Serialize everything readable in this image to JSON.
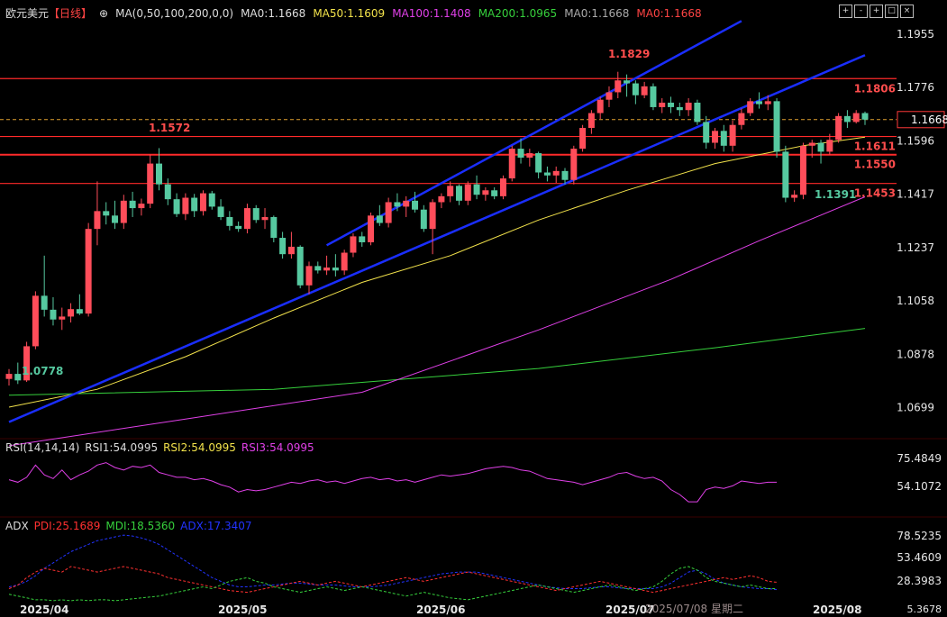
{
  "header": {
    "symbol": "欧元美元",
    "period": "【日线】",
    "ma_param": "MA(0,50,100,200,0,0)",
    "ma0": "MA0:1.1668",
    "ma50": "MA50:1.1609",
    "ma100": "MA100:1.1408",
    "ma200": "MA200:1.0965",
    "ma0b": "MA0:1.1668",
    "ma0c": "MA0:1.1668"
  },
  "toolbar": [
    "+",
    "-",
    "+",
    "□",
    "×"
  ],
  "colors": {
    "up": "#ff4d5a",
    "down": "#56c9a0",
    "ma50": "#f2e24b",
    "ma100": "#e040e8",
    "ma200": "#36d03c",
    "trend": "#1a2eff",
    "level": "#ff2a2a",
    "rsi": "#e040e8",
    "pdi": "#ff3030",
    "mdi": "#36d03c",
    "adx": "#2233ff"
  },
  "price_axis": [
    "1.1955",
    "1.1776",
    "1.1596",
    "1.1417",
    "1.1237",
    "1.1058",
    "1.0878",
    "1.0699"
  ],
  "current_price": "1.1668",
  "levels": [
    "1.1806",
    "1.1611",
    "1.1550",
    "1.1453"
  ],
  "annotations": {
    "high": "1.1829",
    "high_may": "1.1572",
    "low_apr": "1.0778",
    "low_aug": "1.1391"
  },
  "rsi": {
    "label": "RSI(14,14,14)",
    "rsi1": "RSI1:54.0995",
    "rsi2": "RSI2:54.0995",
    "rsi3": "RSI3:54.0995",
    "axis": [
      "75.4849",
      "54.1072"
    ],
    "values": [
      56,
      54,
      58,
      68,
      60,
      57,
      64,
      56,
      60,
      63,
      68,
      70,
      66,
      64,
      67,
      66,
      68,
      62,
      60,
      58,
      58,
      56,
      57,
      55,
      52,
      50,
      46,
      48,
      47,
      48,
      50,
      52,
      54,
      53,
      55,
      56,
      54,
      55,
      53,
      55,
      57,
      58,
      56,
      57,
      55,
      56,
      54,
      56,
      58,
      60,
      59,
      60,
      61,
      63,
      65,
      66,
      67,
      66,
      64,
      63,
      60,
      57,
      56,
      55,
      54,
      52,
      54,
      56,
      58,
      61,
      62,
      59,
      57,
      58,
      55,
      48,
      44,
      38,
      38,
      48,
      50,
      49,
      51,
      55,
      54,
      53,
      54,
      54
    ]
  },
  "adx": {
    "label": "ADX",
    "pdi": "PDI:25.1689",
    "mdi": "MDI:18.5360",
    "adx": "ADX:17.3407",
    "axis": [
      "78.5235",
      "53.4609",
      "28.3983",
      "5.3678"
    ],
    "pdi_values": [
      18,
      22,
      30,
      36,
      40,
      38,
      36,
      42,
      40,
      38,
      36,
      38,
      40,
      42,
      40,
      38,
      36,
      34,
      30,
      28,
      26,
      24,
      22,
      20,
      18,
      16,
      15,
      14,
      16,
      18,
      20,
      22,
      24,
      26,
      24,
      22,
      24,
      26,
      24,
      22,
      20,
      22,
      24,
      26,
      28,
      30,
      28,
      26,
      28,
      30,
      32,
      34,
      36,
      34,
      32,
      30,
      28,
      26,
      24,
      22,
      20,
      18,
      16,
      18,
      20,
      22,
      24,
      26,
      24,
      22,
      20,
      18,
      16,
      14,
      16,
      18,
      20,
      22,
      24,
      26,
      28,
      30,
      28,
      30,
      32,
      30,
      26,
      25
    ],
    "mdi_values": [
      12,
      10,
      8,
      6,
      6,
      5,
      6,
      5,
      6,
      5,
      6,
      6,
      5,
      6,
      7,
      8,
      9,
      10,
      12,
      14,
      16,
      18,
      20,
      18,
      22,
      26,
      28,
      30,
      26,
      24,
      20,
      18,
      16,
      14,
      16,
      18,
      20,
      18,
      16,
      18,
      20,
      18,
      16,
      14,
      12,
      10,
      12,
      14,
      12,
      10,
      8,
      7,
      6,
      8,
      10,
      12,
      14,
      16,
      18,
      20,
      22,
      20,
      18,
      16,
      14,
      16,
      18,
      20,
      22,
      20,
      18,
      16,
      18,
      20,
      26,
      34,
      40,
      42,
      38,
      30,
      26,
      24,
      22,
      20,
      22,
      20,
      18,
      18
    ],
    "adx_values": [
      20,
      22,
      26,
      32,
      40,
      46,
      52,
      58,
      62,
      66,
      70,
      72,
      74,
      76,
      75,
      73,
      70,
      66,
      60,
      54,
      48,
      42,
      36,
      30,
      26,
      22,
      20,
      20,
      21,
      22,
      22,
      23,
      24,
      24,
      23,
      22,
      22,
      22,
      21,
      20,
      20,
      20,
      21,
      22,
      24,
      26,
      28,
      30,
      32,
      34,
      35,
      36,
      36,
      36,
      34,
      32,
      30,
      28,
      26,
      24,
      22,
      20,
      19,
      18,
      18,
      18,
      19,
      20,
      20,
      19,
      18,
      18,
      18,
      18,
      20,
      24,
      30,
      36,
      38,
      34,
      28,
      24,
      22,
      20,
      19,
      18,
      18,
      17
    ]
  },
  "xaxis": {
    "labels": [
      "2025/04",
      "2025/05",
      "2025/06",
      "2025/07",
      "2025/07/08 星期二",
      "2025/08"
    ]
  },
  "chart_data": {
    "type": "line",
    "candles": [
      [
        1.0795,
        1.0828,
        1.0773,
        1.0812
      ],
      [
        1.0812,
        1.085,
        1.0778,
        1.079
      ],
      [
        1.079,
        1.092,
        1.0785,
        1.0905
      ],
      [
        1.0905,
        1.109,
        1.0895,
        1.1075
      ],
      [
        1.1075,
        1.121,
        1.1005,
        1.1028
      ],
      [
        1.1028,
        1.107,
        1.0975,
        1.0995
      ],
      [
        1.0995,
        1.1035,
        1.096,
        1.1005
      ],
      [
        1.1005,
        1.105,
        1.0985,
        1.103
      ],
      [
        1.103,
        1.108,
        1.101,
        1.1015
      ],
      [
        1.1015,
        1.132,
        1.1005,
        1.13
      ],
      [
        1.13,
        1.146,
        1.1245,
        1.136
      ],
      [
        1.136,
        1.139,
        1.1315,
        1.1345
      ],
      [
        1.1345,
        1.1395,
        1.13,
        1.132
      ],
      [
        1.132,
        1.1415,
        1.13,
        1.1395
      ],
      [
        1.1395,
        1.1425,
        1.134,
        1.137
      ],
      [
        1.137,
        1.1402,
        1.1345,
        1.1385
      ],
      [
        1.1385,
        1.155,
        1.137,
        1.152
      ],
      [
        1.152,
        1.1572,
        1.143,
        1.145
      ],
      [
        1.145,
        1.147,
        1.138,
        1.14
      ],
      [
        1.14,
        1.142,
        1.134,
        1.135
      ],
      [
        1.135,
        1.142,
        1.133,
        1.1405
      ],
      [
        1.1405,
        1.1418,
        1.134,
        1.136
      ],
      [
        1.136,
        1.143,
        1.1345,
        1.142
      ],
      [
        1.142,
        1.1428,
        1.1365,
        1.1375
      ],
      [
        1.1375,
        1.14,
        1.133,
        1.134
      ],
      [
        1.134,
        1.136,
        1.1295,
        1.131
      ],
      [
        1.131,
        1.1325,
        1.129,
        1.13
      ],
      [
        1.13,
        1.1385,
        1.1285,
        1.137
      ],
      [
        1.137,
        1.138,
        1.132,
        1.133
      ],
      [
        1.133,
        1.137,
        1.13,
        1.134
      ],
      [
        1.134,
        1.1345,
        1.1255,
        1.127
      ],
      [
        1.127,
        1.129,
        1.12,
        1.1215
      ],
      [
        1.1215,
        1.129,
        1.12,
        1.124
      ],
      [
        1.124,
        1.1245,
        1.11,
        1.111
      ],
      [
        1.111,
        1.119,
        1.108,
        1.1175
      ],
      [
        1.1175,
        1.119,
        1.115,
        1.116
      ],
      [
        1.116,
        1.121,
        1.1145,
        1.117
      ],
      [
        1.117,
        1.1215,
        1.114,
        1.116
      ],
      [
        1.116,
        1.123,
        1.1145,
        1.122
      ],
      [
        1.122,
        1.1285,
        1.1205,
        1.1275
      ],
      [
        1.1275,
        1.129,
        1.124,
        1.1255
      ],
      [
        1.1255,
        1.1355,
        1.1245,
        1.1345
      ],
      [
        1.1345,
        1.138,
        1.131,
        1.132
      ],
      [
        1.132,
        1.1405,
        1.1305,
        1.139
      ],
      [
        1.139,
        1.142,
        1.136,
        1.1375
      ],
      [
        1.1375,
        1.141,
        1.134,
        1.1395
      ],
      [
        1.1395,
        1.1425,
        1.1355,
        1.1365
      ],
      [
        1.1365,
        1.138,
        1.129,
        1.13
      ],
      [
        1.13,
        1.14,
        1.1215,
        1.139
      ],
      [
        1.139,
        1.142,
        1.137,
        1.141
      ],
      [
        1.141,
        1.146,
        1.139,
        1.1445
      ],
      [
        1.1445,
        1.145,
        1.138,
        1.1395
      ],
      [
        1.1395,
        1.146,
        1.138,
        1.145
      ],
      [
        1.145,
        1.148,
        1.14,
        1.1415
      ],
      [
        1.1415,
        1.144,
        1.1395,
        1.143
      ],
      [
        1.143,
        1.144,
        1.14,
        1.141
      ],
      [
        1.141,
        1.148,
        1.14,
        1.147
      ],
      [
        1.147,
        1.158,
        1.146,
        1.157
      ],
      [
        1.157,
        1.1605,
        1.152,
        1.154
      ],
      [
        1.154,
        1.157,
        1.151,
        1.1555
      ],
      [
        1.1555,
        1.156,
        1.147,
        1.149
      ],
      [
        1.149,
        1.151,
        1.146,
        1.148
      ],
      [
        1.148,
        1.151,
        1.1455,
        1.1495
      ],
      [
        1.1495,
        1.1505,
        1.145,
        1.1465
      ],
      [
        1.1465,
        1.158,
        1.145,
        1.157
      ],
      [
        1.157,
        1.165,
        1.156,
        1.164
      ],
      [
        1.164,
        1.17,
        1.162,
        1.169
      ],
      [
        1.169,
        1.1745,
        1.167,
        1.1735
      ],
      [
        1.1735,
        1.178,
        1.171,
        1.176
      ],
      [
        1.176,
        1.1829,
        1.174,
        1.18
      ],
      [
        1.18,
        1.182,
        1.1745,
        1.179
      ],
      [
        1.179,
        1.18,
        1.172,
        1.175
      ],
      [
        1.175,
        1.1795,
        1.174,
        1.178
      ],
      [
        1.178,
        1.179,
        1.17,
        1.171
      ],
      [
        1.171,
        1.174,
        1.169,
        1.1725
      ],
      [
        1.1725,
        1.1745,
        1.169,
        1.171
      ],
      [
        1.171,
        1.1725,
        1.168,
        1.17
      ],
      [
        1.17,
        1.174,
        1.168,
        1.1725
      ],
      [
        1.1725,
        1.1735,
        1.165,
        1.166
      ],
      [
        1.166,
        1.168,
        1.157,
        1.159
      ],
      [
        1.159,
        1.164,
        1.157,
        1.163
      ],
      [
        1.163,
        1.165,
        1.156,
        1.158
      ],
      [
        1.158,
        1.1665,
        1.156,
        1.165
      ],
      [
        1.165,
        1.1705,
        1.1635,
        1.169
      ],
      [
        1.169,
        1.174,
        1.168,
        1.173
      ],
      [
        1.173,
        1.176,
        1.1705,
        1.172
      ],
      [
        1.172,
        1.175,
        1.17,
        1.173
      ],
      [
        1.173,
        1.174,
        1.154,
        1.156
      ],
      [
        1.156,
        1.158,
        1.139,
        1.1405
      ],
      [
        1.1405,
        1.143,
        1.1391,
        1.1415
      ],
      [
        1.1415,
        1.159,
        1.14,
        1.158
      ],
      [
        1.158,
        1.16,
        1.154,
        1.159
      ],
      [
        1.159,
        1.16,
        1.152,
        1.156
      ],
      [
        1.156,
        1.162,
        1.155,
        1.16
      ],
      [
        1.16,
        1.169,
        1.159,
        1.168
      ],
      [
        1.168,
        1.17,
        1.164,
        1.166
      ],
      [
        1.166,
        1.17,
        1.1655,
        1.169
      ],
      [
        1.169,
        1.1695,
        1.165,
        1.1668
      ]
    ],
    "ma50": [
      [
        0,
        1.07
      ],
      [
        10,
        1.076
      ],
      [
        20,
        1.087
      ],
      [
        30,
        1.1
      ],
      [
        40,
        1.112
      ],
      [
        50,
        1.121
      ],
      [
        60,
        1.133
      ],
      [
        70,
        1.143
      ],
      [
        80,
        1.152
      ],
      [
        90,
        1.158
      ],
      [
        97,
        1.1609
      ]
    ],
    "ma100": [
      [
        0,
        1.057
      ],
      [
        20,
        1.066
      ],
      [
        40,
        1.075
      ],
      [
        60,
        1.096
      ],
      [
        75,
        1.113
      ],
      [
        85,
        1.126
      ],
      [
        97,
        1.1408
      ]
    ],
    "ma200": [
      [
        0,
        1.074
      ],
      [
        30,
        1.076
      ],
      [
        60,
        1.083
      ],
      [
        80,
        1.09
      ],
      [
        97,
        1.0965
      ]
    ],
    "trendlines": [
      [
        [
          0,
          1.065
        ],
        [
          97,
          1.1885
        ]
      ],
      [
        [
          36,
          1.1245
        ],
        [
          83,
          1.2
        ]
      ]
    ],
    "ylim": [
      1.06,
      1.201
    ]
  }
}
